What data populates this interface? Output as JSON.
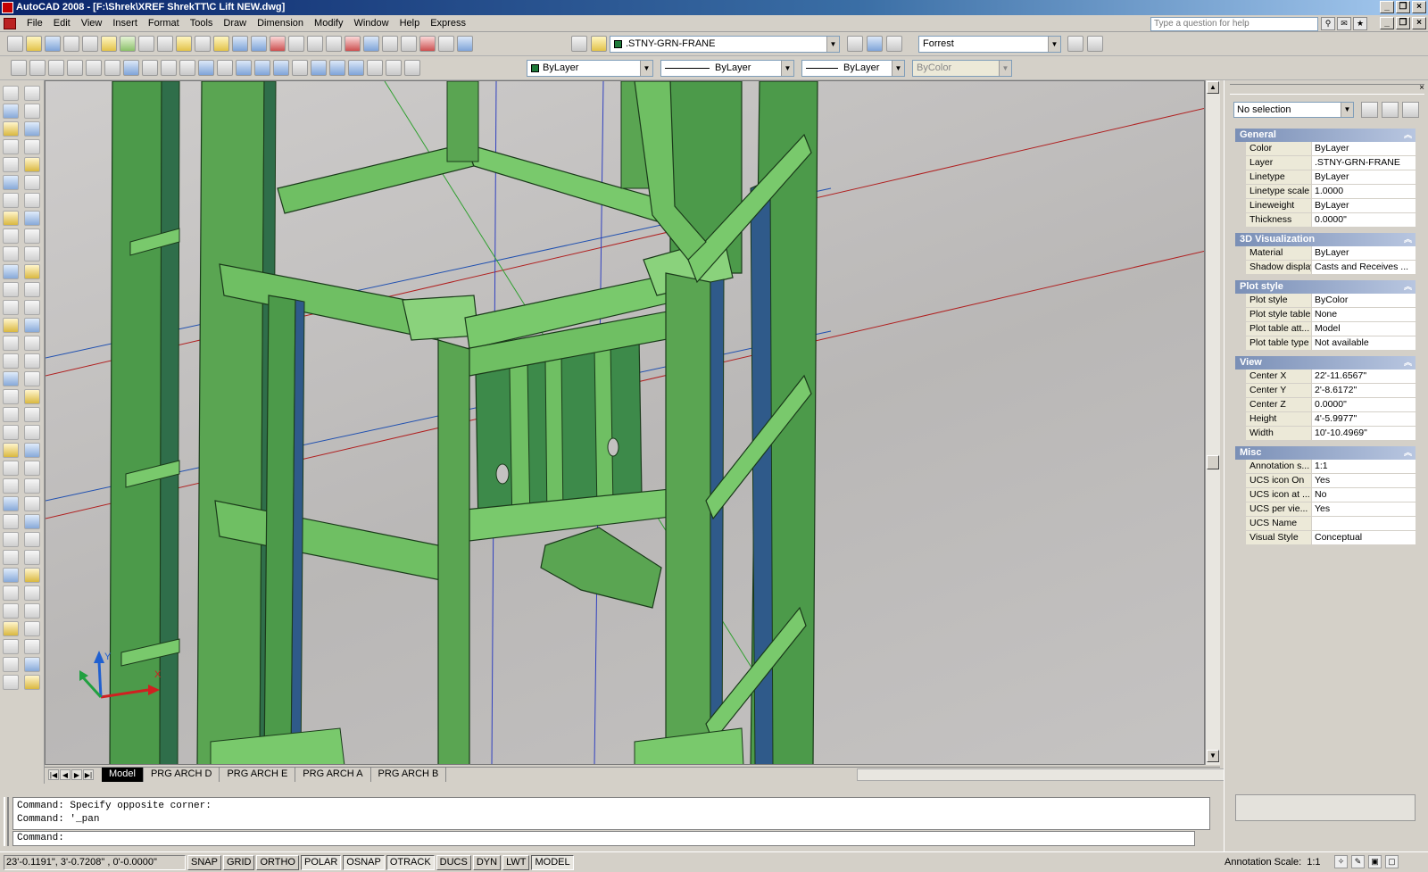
{
  "title": "AutoCAD 2008 - [F:\\Shrek\\XREF ShrekTT\\C Lift NEW.dwg]",
  "menus": [
    "File",
    "Edit",
    "View",
    "Insert",
    "Format",
    "Tools",
    "Draw",
    "Dimension",
    "Modify",
    "Window",
    "Help",
    "Express"
  ],
  "help_placeholder": "Type a question for help",
  "toolbar": {
    "layer": ".STNY-GRN-FRANE",
    "style": "Forrest",
    "color": "ByLayer",
    "linetype": "ByLayer",
    "lineweight": "ByLayer",
    "plotstyle": "ByColor"
  },
  "layout_tabs": [
    "Model",
    "PRG ARCH D",
    "PRG ARCH E",
    "PRG ARCH A",
    "PRG ARCH B"
  ],
  "command": {
    "history": [
      "Command: Specify opposite corner:",
      "Command: '_pan"
    ],
    "prompt": "Command:"
  },
  "status": {
    "coords": "23'-0.1191\", 3'-0.7208\" , 0'-0.0000\"",
    "buttons": [
      "SNAP",
      "GRID",
      "ORTHO",
      "POLAR",
      "OSNAP",
      "OTRACK",
      "DUCS",
      "DYN",
      "LWT",
      "MODEL"
    ],
    "annotation_label": "Annotation Scale:",
    "annotation_value": "1:1"
  },
  "properties": {
    "selection": "No selection",
    "sections": [
      {
        "name": "General",
        "rows": [
          [
            "Color",
            "ByLayer"
          ],
          [
            "Layer",
            ".STNY-GRN-FRANE"
          ],
          [
            "Linetype",
            "ByLayer"
          ],
          [
            "Linetype scale",
            "1.0000"
          ],
          [
            "Lineweight",
            "ByLayer"
          ],
          [
            "Thickness",
            "0.0000\""
          ]
        ]
      },
      {
        "name": "3D Visualization",
        "rows": [
          [
            "Material",
            "ByLayer"
          ],
          [
            "Shadow display",
            "Casts and Receives ..."
          ]
        ]
      },
      {
        "name": "Plot style",
        "rows": [
          [
            "Plot style",
            "ByColor"
          ],
          [
            "Plot style table",
            "None"
          ],
          [
            "Plot table att...",
            "Model"
          ],
          [
            "Plot table type",
            "Not available"
          ]
        ]
      },
      {
        "name": "View",
        "rows": [
          [
            "Center X",
            "22'-11.6567\""
          ],
          [
            "Center Y",
            "2'-8.6172\""
          ],
          [
            "Center Z",
            "0.0000\""
          ],
          [
            "Height",
            "4'-5.9977\""
          ],
          [
            "Width",
            "10'-10.4969\""
          ]
        ]
      },
      {
        "name": "Misc",
        "rows": [
          [
            "Annotation s...",
            "1:1"
          ],
          [
            "UCS icon On",
            "Yes"
          ],
          [
            "UCS icon at ...",
            "No"
          ],
          [
            "UCS per vie...",
            "Yes"
          ],
          [
            "UCS Name",
            ""
          ],
          [
            "Visual Style",
            "Conceptual"
          ]
        ]
      }
    ]
  },
  "ucs": {
    "x": "X",
    "y": "Y",
    "z": "Z"
  },
  "colors": {
    "steel": "#6fbf63",
    "steel_dark": "#4a8f43",
    "steel_shadow": "#2f6e4a",
    "viewport": "#c4c2c1"
  }
}
